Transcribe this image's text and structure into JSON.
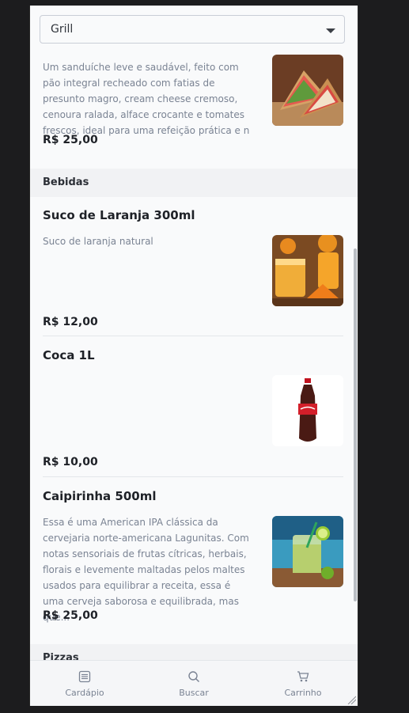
{
  "category_select": {
    "value": "Grill"
  },
  "items": [
    {
      "title": "",
      "description": "Um sanduíche leve e saudável, feito com pão integral recheado com fatias de presunto magro, cream cheese cremoso, cenoura ralada, alface crocante e tomates frescos, ideal para uma refeição prática e n",
      "price": "R$ 25,00"
    }
  ],
  "sections": [
    {
      "label": "Bebidas"
    },
    {
      "label": "Pizzas"
    }
  ],
  "bebidas": [
    {
      "title": "Suco de Laranja 300ml",
      "description": "Suco de laranja natural",
      "price": "R$ 12,00"
    },
    {
      "title": "Coca 1L",
      "description": "",
      "price": "R$ 10,00"
    },
    {
      "title": "Caipirinha 500ml",
      "description": "Essa é uma American IPA clássica da cervejaria norte-americana Lagunitas. Com notas sensoriais de frutas cítricas, herbais, florais e levemente maltadas pelos maltes usados para equilibrar a receita, essa é uma cerveja saborosa e equilibrada, mas que...",
      "price": "R$ 25,00"
    }
  ],
  "bottom_nav": [
    {
      "label": "Cardápio",
      "icon": "menu-list-icon"
    },
    {
      "label": "Buscar",
      "icon": "search-icon"
    },
    {
      "label": "Carrinho",
      "icon": "cart-icon"
    }
  ]
}
